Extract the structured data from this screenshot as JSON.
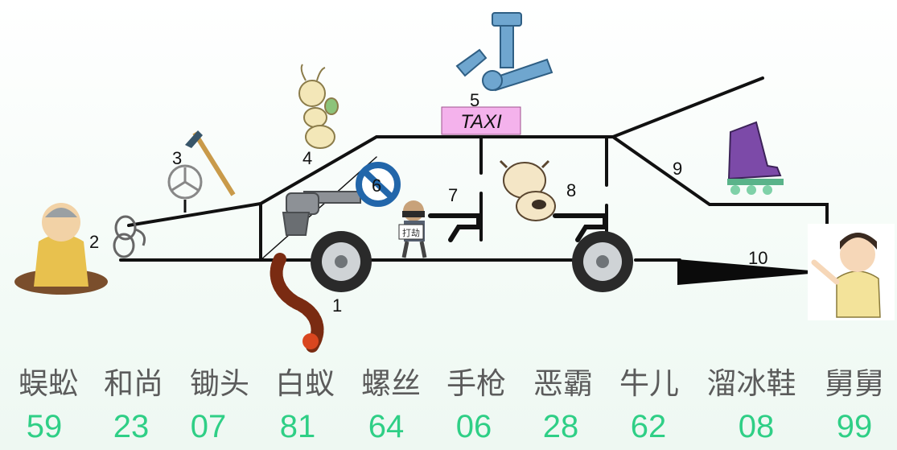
{
  "taxi_sign": "TAXI",
  "robber_sign": "打劫",
  "numbers": [
    "1",
    "2",
    "3",
    "4",
    "5",
    "6",
    "7",
    "8",
    "9",
    "10"
  ],
  "items": [
    {
      "word": "蜈蚣",
      "code": "59"
    },
    {
      "word": "和尚",
      "code": "23"
    },
    {
      "word": "锄头",
      "code": "07"
    },
    {
      "word": "白蚁",
      "code": "81"
    },
    {
      "word": "螺丝",
      "code": "64"
    },
    {
      "word": "手枪",
      "code": "06"
    },
    {
      "word": "恶霸",
      "code": "28"
    },
    {
      "word": "牛儿",
      "code": "62"
    },
    {
      "word": "溜冰鞋",
      "code": "08"
    },
    {
      "word": "舅舅",
      "code": "99"
    }
  ],
  "colors": {
    "code_text": "#2fcf86",
    "word_text": "#5b5b5b",
    "taxi_sign": "#f4b2ec",
    "line": "#111111"
  }
}
